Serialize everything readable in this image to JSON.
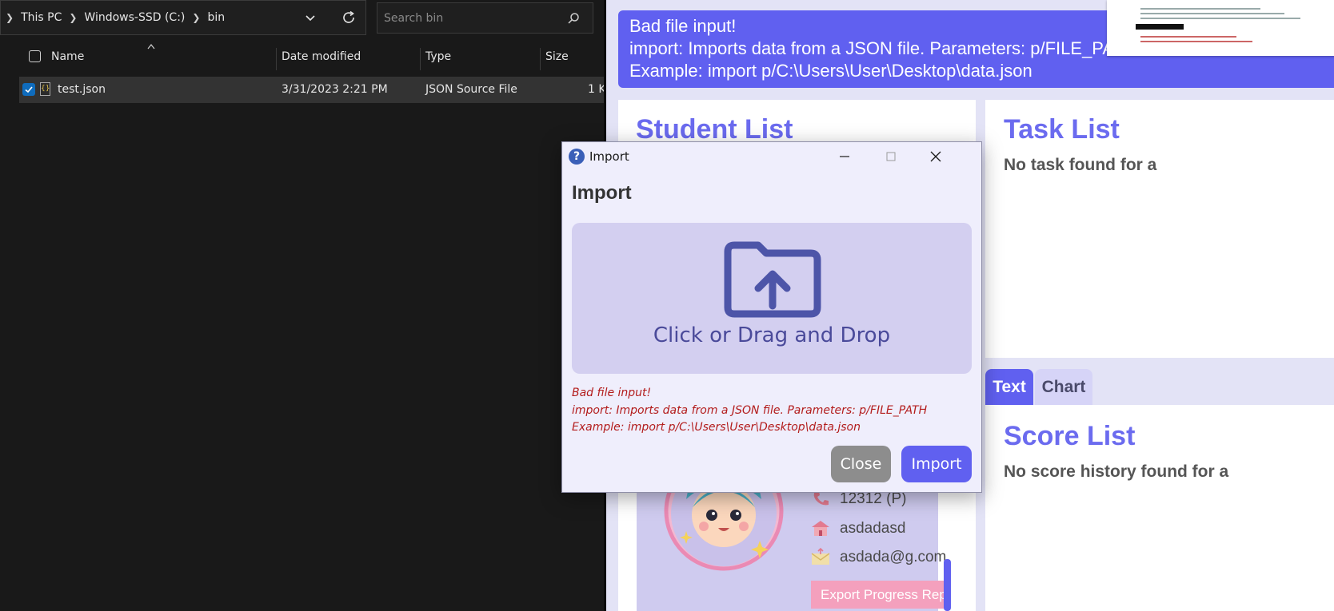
{
  "explorer": {
    "breadcrumb": [
      "This PC",
      "Windows-SSD (C:)",
      "bin"
    ],
    "search_placeholder": "Search bin",
    "columns": [
      "Name",
      "Date modified",
      "Type",
      "Size"
    ],
    "file": {
      "name": "test.json",
      "date": "3/31/2023 2:21 PM",
      "type": "JSON Source File",
      "size": "1 K",
      "icon_glyph": "{}"
    }
  },
  "app": {
    "banner_lines": [
      "Bad file input!",
      "import: Imports data from a JSON file. Parameters: p/FILE_PATH",
      "Example: import p/C:\\Users\\User\\Desktop\\data.json"
    ],
    "student_list_title": "Student List",
    "task_list_title": "Task List",
    "task_empty": "No task found for a",
    "tabs": [
      "Text",
      "Chart"
    ],
    "score_list_title": "Score List",
    "score_empty": "No score history found for a",
    "student": {
      "phone": "12312 (P)",
      "address": "asdadasd",
      "email": "asdada@g.com"
    },
    "export_label": "Export Progress Report"
  },
  "dialog": {
    "window_title": "Import",
    "heading": "Import",
    "drop_label": "Click or Drag and Drop",
    "error_lines": [
      "Bad file input!",
      "import: Imports data from a JSON file. Parameters: p/FILE_PATH",
      "Example: import p/C:\\Users\\User\\Desktop\\data.json"
    ],
    "close_label": "Close",
    "import_label": "Import"
  },
  "icons": {
    "help": "question-icon",
    "minimize": "minimize-icon",
    "maximize": "maximize-icon",
    "close": "close-icon",
    "folder": "folder-upload-icon",
    "search": "search-icon",
    "refresh": "refresh-icon",
    "phone": "phone-icon",
    "home": "home-icon",
    "email": "email-icon"
  },
  "colors": {
    "accent": "#6060f0",
    "error": "#b31c1c",
    "dropzone": "#d3cff0",
    "explorer_bg": "#191919"
  }
}
